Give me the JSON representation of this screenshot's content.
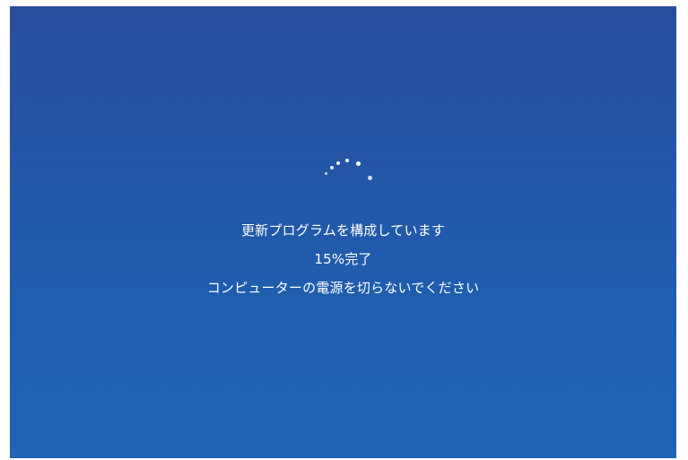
{
  "update_screen": {
    "title": "更新プログラムを構成しています",
    "progress_text": "15%完了",
    "progress_percent": 15,
    "warning": "コンピューターの電源を切らないでください",
    "background_top": "#2a4d9e",
    "background_bottom": "#1f63b3",
    "text_color": "#ffffff",
    "spinner_icon": "loading-spinner-icon"
  }
}
